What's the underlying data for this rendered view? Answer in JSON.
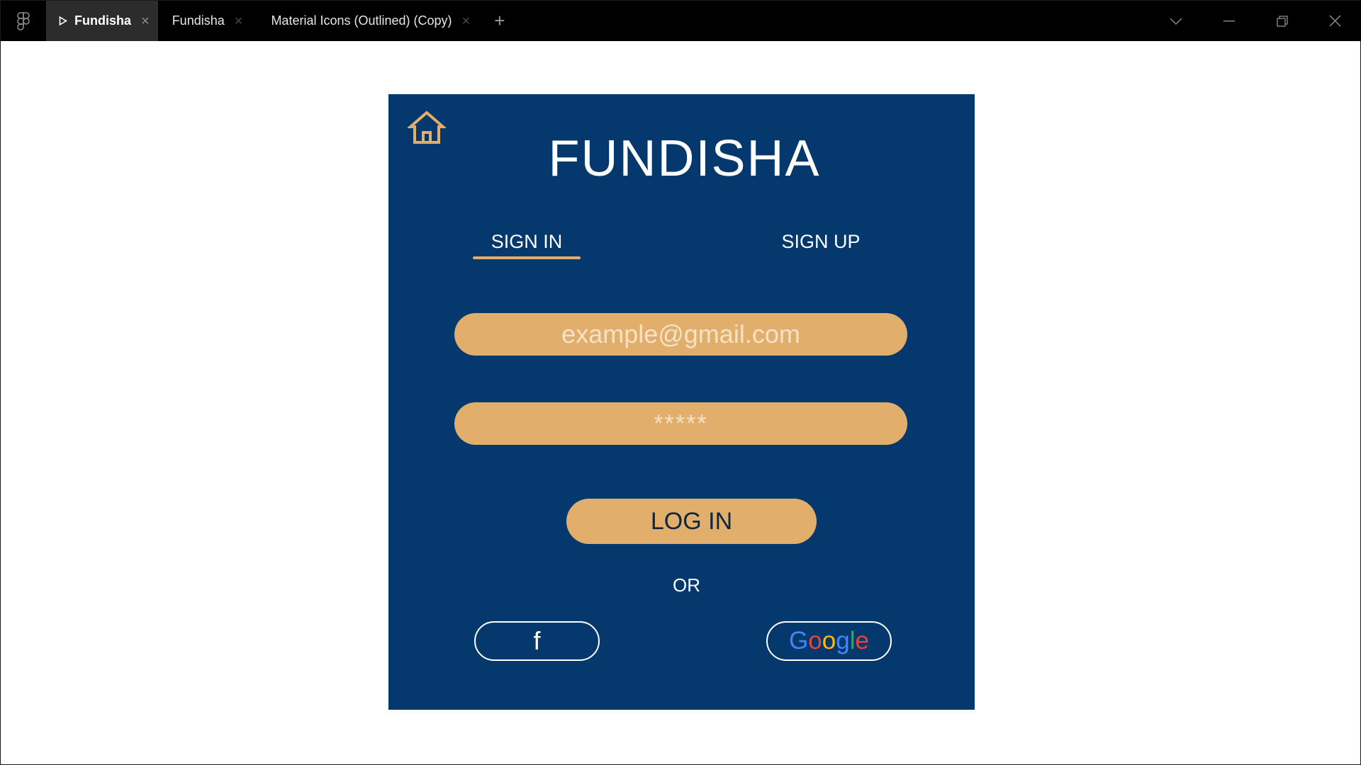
{
  "tabbar": {
    "tabs": [
      {
        "label": "Fundisha",
        "active": true
      },
      {
        "label": "Fundisha",
        "active": false
      },
      {
        "label": "Material Icons (Outlined) (Copy)",
        "active": false
      }
    ],
    "close_glyph": "×",
    "new_tab_glyph": "+",
    "icons": [
      "figma-logo-icon",
      "play-icon",
      "chevron-down-icon",
      "minimize-icon",
      "restore-icon",
      "close-window-icon"
    ]
  },
  "app": {
    "brand": "FUNDISHA",
    "tabs": {
      "signin": "SIGN IN",
      "signup": "SIGN UP"
    },
    "email_placeholder": "example@gmail.com",
    "password_placeholder": "*****",
    "login_label": "LOG IN",
    "or_label": "OR",
    "facebook_label": "f",
    "google_letters": [
      "G",
      "o",
      "o",
      "g",
      "l",
      "e"
    ]
  },
  "colors": {
    "frame_bg": "#05396d",
    "accent": "#e2ae6c",
    "placeholder_text": "#f4e2c6",
    "login_text": "#0d2743",
    "google_blue": "#4285f4",
    "google_red": "#ea4335",
    "google_yellow": "#fbbc05",
    "google_green": "#34a853"
  }
}
